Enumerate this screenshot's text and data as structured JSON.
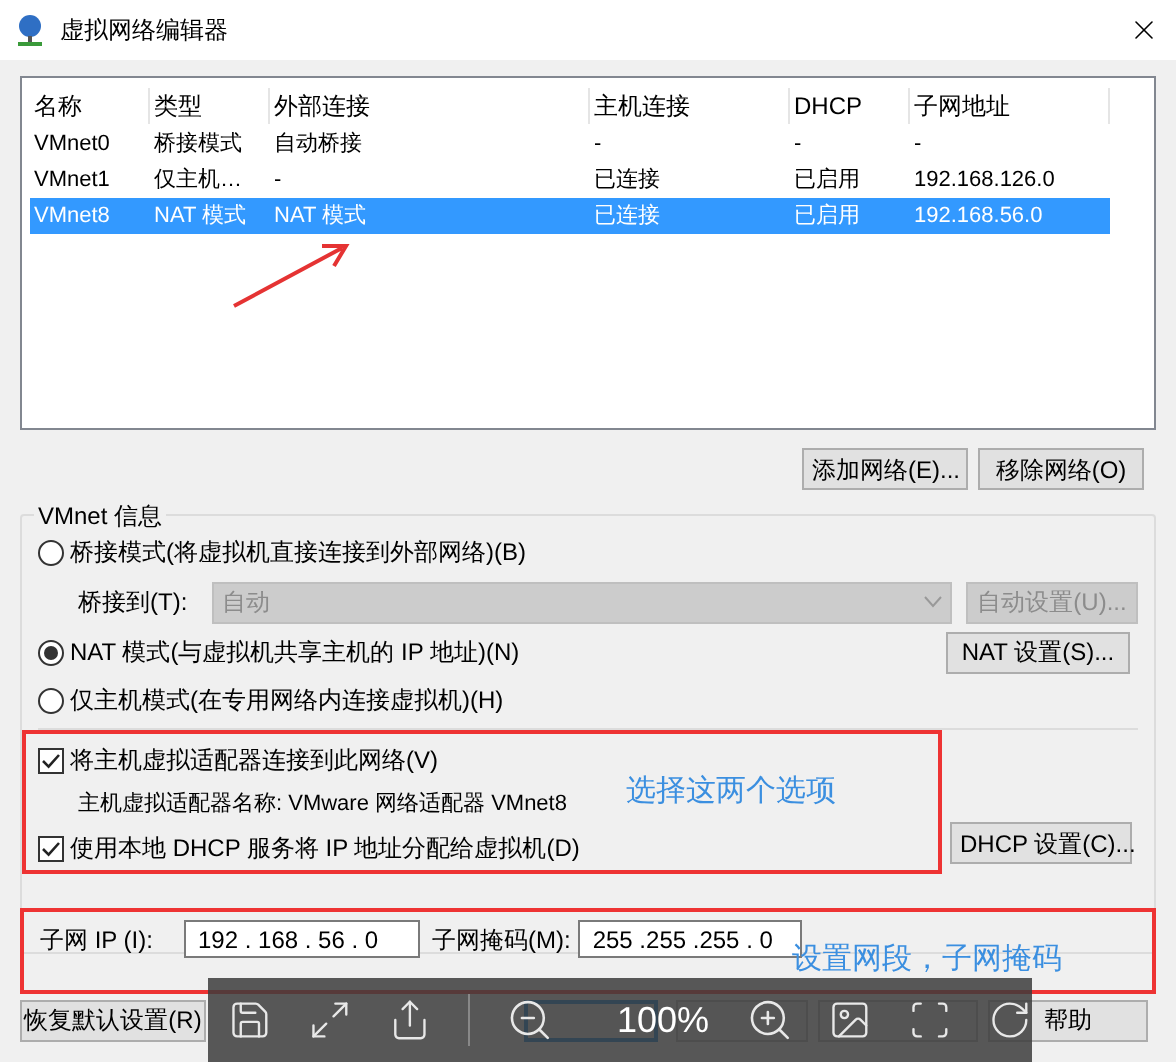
{
  "window": {
    "title": "虚拟网络编辑器"
  },
  "table": {
    "columns": [
      "名称",
      "类型",
      "外部连接",
      "主机连接",
      "DHCP",
      "子网地址"
    ],
    "rows": [
      {
        "cells": [
          "VMnet0",
          "桥接模式",
          "自动桥接",
          "-",
          "-",
          "-"
        ],
        "selected": false
      },
      {
        "cells": [
          "VMnet1",
          "仅主机…",
          "-",
          "已连接",
          "已启用",
          "192.168.126.0"
        ],
        "selected": false
      },
      {
        "cells": [
          "VMnet8",
          "NAT 模式",
          "NAT 模式",
          "已连接",
          "已启用",
          "192.168.56.0"
        ],
        "selected": true
      }
    ]
  },
  "list_buttons": [
    {
      "label": "添加网络(E)...",
      "disabled": false
    },
    {
      "label": "移除网络(O)",
      "disabled": false
    }
  ],
  "vmnet_info": {
    "title": "VMnet 信息",
    "bridged": {
      "label": "桥接模式(将虚拟机直接连接到外部网络)(B)",
      "selected": false
    },
    "bridge_to": {
      "label": "桥接到(T):",
      "value": "自动",
      "disabled": true,
      "button": {
        "label": "自动设置(U)...",
        "disabled": true
      }
    },
    "nat": {
      "label": "NAT 模式(与虚拟机共享主机的 IP 地址)(N)",
      "selected": true,
      "button": {
        "label": "NAT 设置(S)...",
        "disabled": false
      }
    },
    "host_only": {
      "label": "仅主机模式(在专用网络内连接虚拟机)(H)",
      "selected": false
    },
    "connect_adapter": {
      "label": "将主机虚拟适配器连接到此网络(V)",
      "checked": true
    },
    "adapter_name": "主机虚拟适配器名称: VMware 网络适配器 VMnet8",
    "use_dhcp": {
      "label": "使用本地 DHCP 服务将 IP 地址分配给虚拟机(D)",
      "checked": true
    },
    "dhcp_button": {
      "label": "DHCP 设置(C)...",
      "disabled": false
    },
    "subnet_ip": {
      "label": "子网 IP (I):",
      "value": "192 . 168 . 56 . 0"
    },
    "subnet_mask": {
      "label": "子网掩码(M):",
      "value": "255 .255 .255 . 0"
    }
  },
  "annotations": [
    "选择这两个选项",
    "设置网段，子网掩码"
  ],
  "footer_buttons": [
    {
      "label": "恢复默认设置(R)",
      "default": false
    },
    {
      "default": true
    },
    {
      "default": false
    },
    {
      "default": false
    },
    {
      "label": "帮助",
      "default": false
    }
  ],
  "viewer_toolbar": {
    "zoom": "100%"
  }
}
